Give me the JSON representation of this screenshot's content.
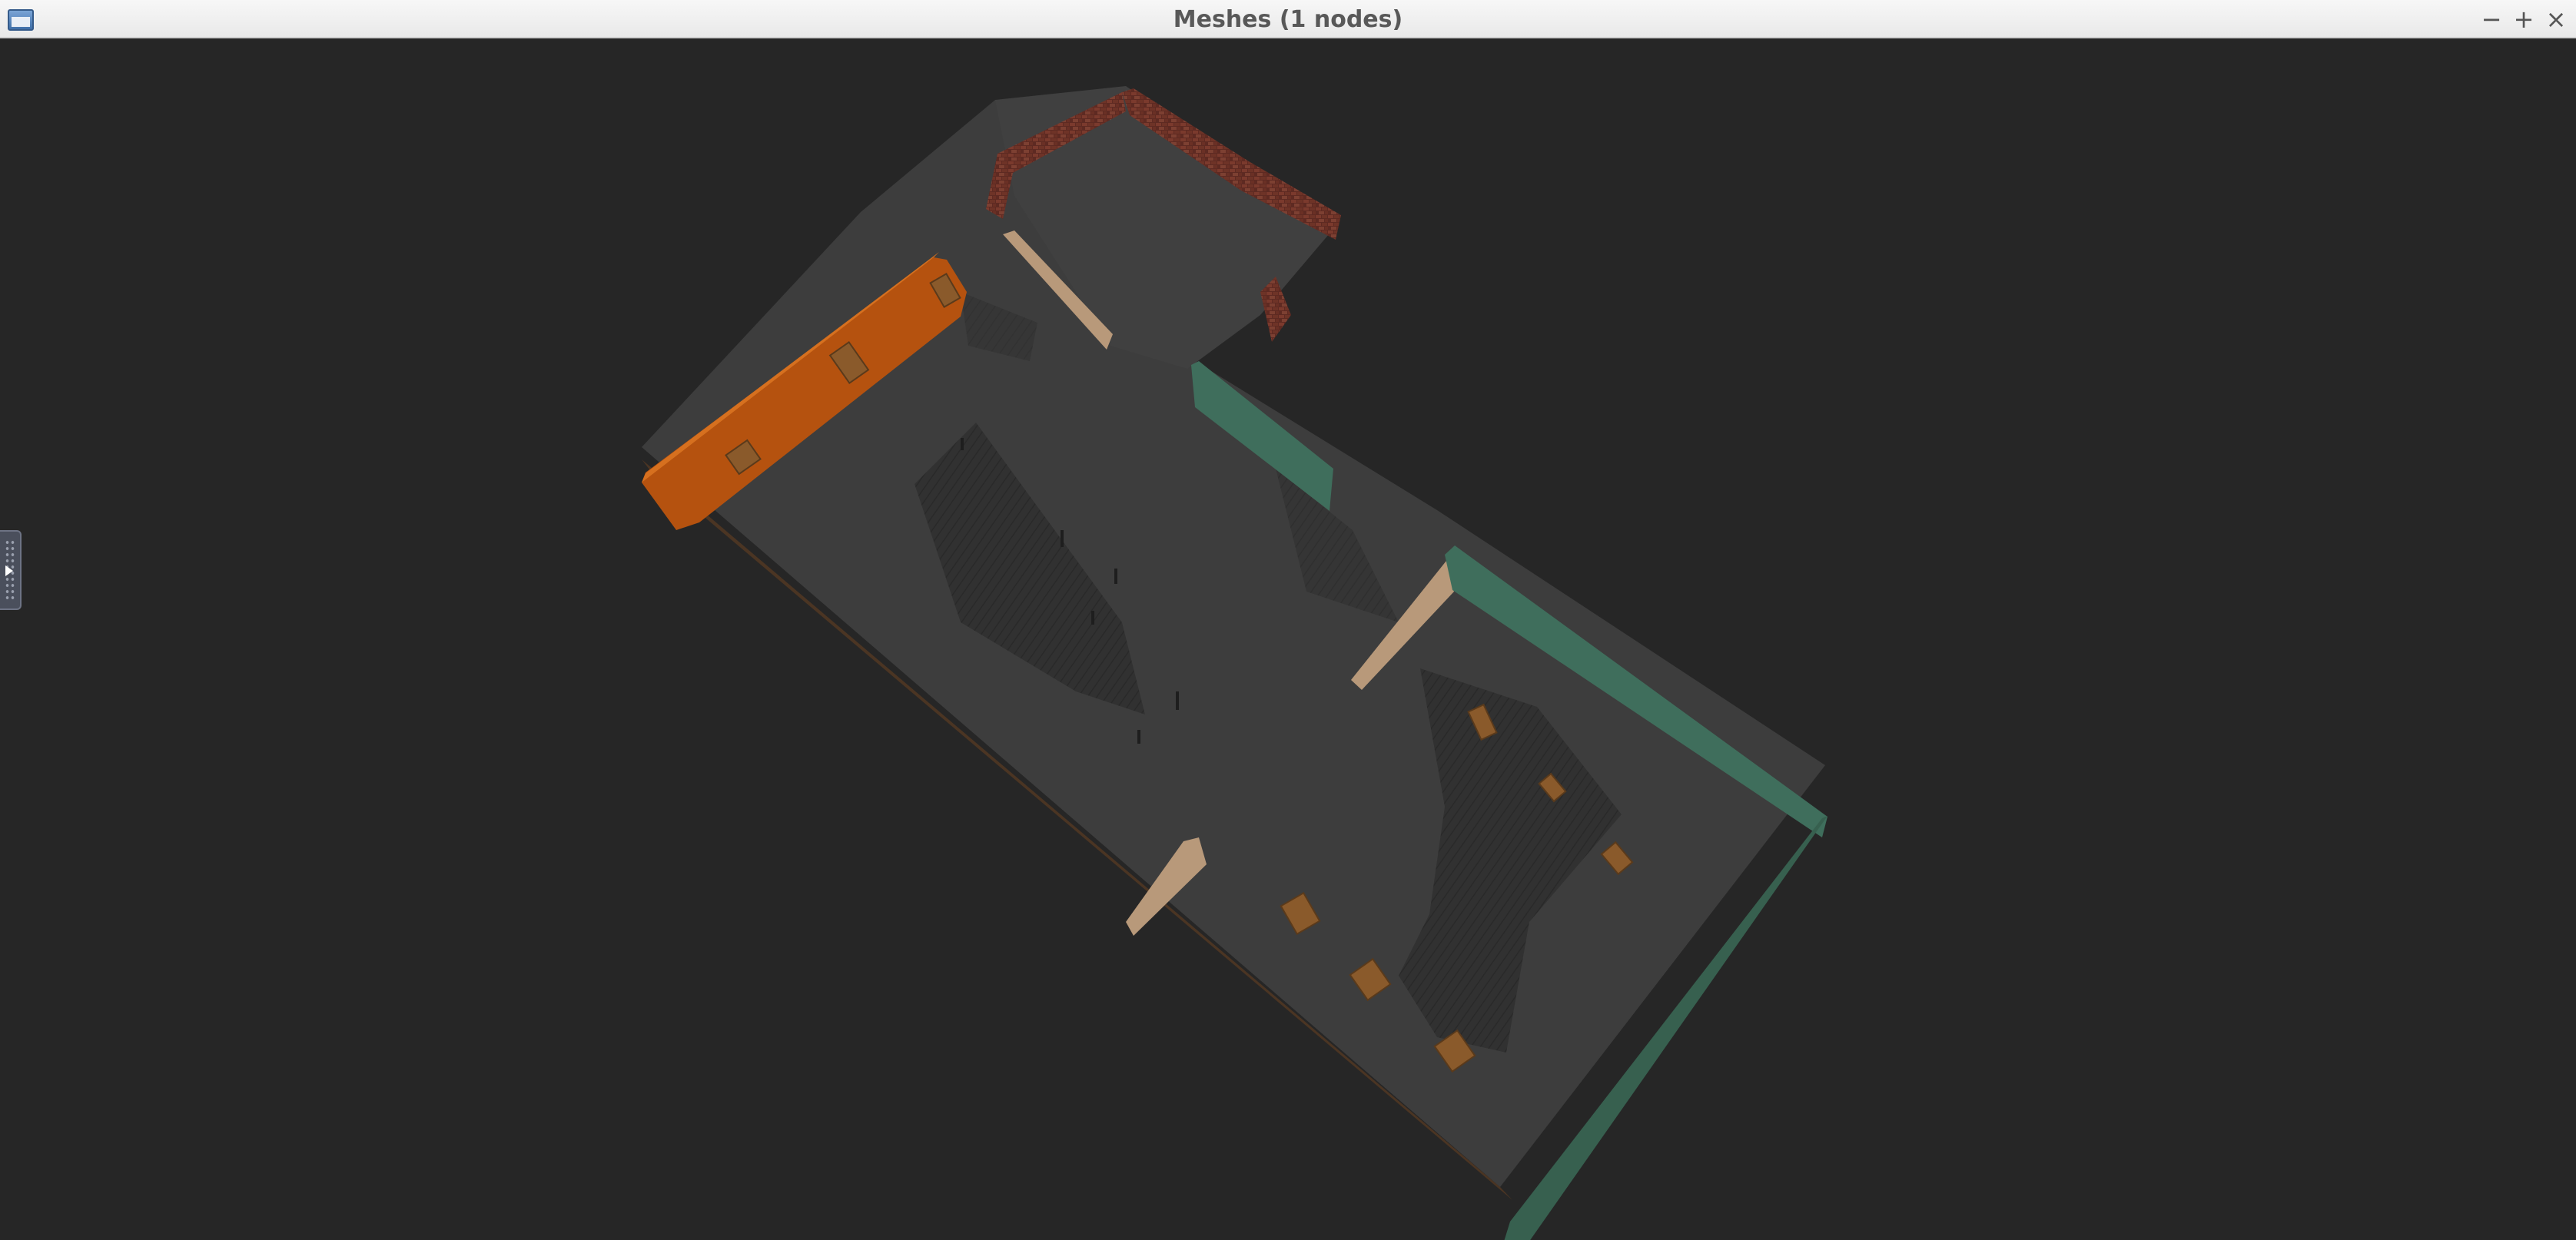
{
  "window": {
    "title": "Meshes (1 nodes)",
    "controls": {
      "minimize": "−",
      "maximize": "+",
      "close": "×"
    },
    "icon": "application-window-icon"
  },
  "viewport": {
    "background_color": "#262626",
    "scene": "3D mesh render of a multi-room interior (top-down perspective view)",
    "floor_color": "#3d3d3d",
    "wall_colors": {
      "orange_wall": "#b5520f",
      "green_wall": "#3f6e5c",
      "tan_wall": "#b8997a",
      "brick_wall": "#6b3127"
    },
    "furniture_color": "#8a5a2b"
  },
  "side_panel": {
    "handle_icon": "expand-panel-arrow-icon",
    "state": "collapsed"
  }
}
